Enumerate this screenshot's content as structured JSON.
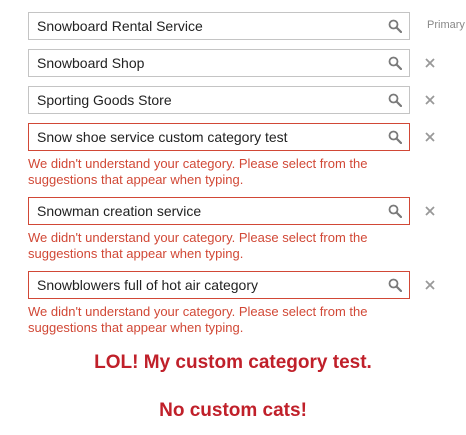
{
  "categories": [
    {
      "value": "Snowboard Rental Service",
      "side": "Primary",
      "error": ""
    },
    {
      "value": "Snowboard Shop",
      "side": "remove",
      "error": ""
    },
    {
      "value": "Sporting Goods Store",
      "side": "remove",
      "error": ""
    },
    {
      "value": "Snow shoe service custom category test",
      "side": "remove",
      "error": "We didn't understand your category. Please select from the suggestions that appear when typing."
    },
    {
      "value": "Snowman creation service",
      "side": "remove",
      "error": "We didn't understand your category. Please select from the suggestions that appear when typing."
    },
    {
      "value": "Snowblowers full of hot air category",
      "side": "remove",
      "error": "We didn't understand your category. Please select from the suggestions that appear when typing."
    }
  ],
  "primary_label": "Primary",
  "annotation": {
    "line1": "LOL! My custom category test.",
    "line2": "No custom cats!"
  },
  "icons": {
    "search": "search-icon",
    "remove": "close-icon"
  },
  "colors": {
    "error": "#d14836",
    "annotation": "#c0202a",
    "border": "#c4c4c4"
  }
}
